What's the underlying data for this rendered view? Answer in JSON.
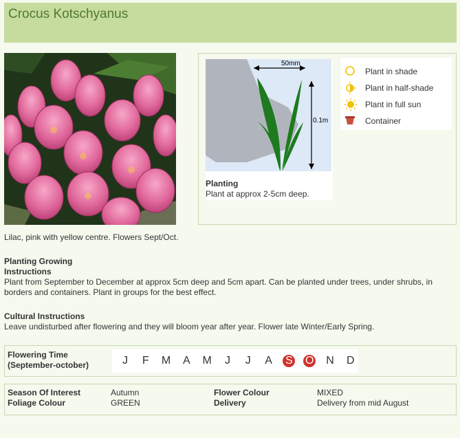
{
  "title": "Crocus Kotschyanus",
  "photo": {
    "alt": "Pink crocus flowers"
  },
  "planting": {
    "width_label": "50mm",
    "height_label": "0.1m",
    "title": "Planting",
    "text": "Plant at approx 2-5cm deep."
  },
  "legend": [
    {
      "label": "Plant in shade",
      "icon": "shade-icon",
      "color": "#f2c200"
    },
    {
      "label": "Plant in half-shade",
      "icon": "half-shade-icon",
      "color": "#f2c200"
    },
    {
      "label": "Plant in full sun",
      "icon": "full-sun-icon",
      "color": "#f2c200"
    },
    {
      "label": "Container",
      "icon": "container-icon",
      "color": "#c8503c"
    }
  ],
  "description": "Lilac, pink with yellow centre. Flowers Sept/Oct.",
  "planting_instructions": {
    "title_line1": "Planting Growing",
    "title_line2": "Instructions",
    "line1": "Plant from September to December at approx 5cm deep and 5cm apart. Can be planted under trees, under shrubs, in",
    "line2": "borders and containers. Plant in groups for the best effect."
  },
  "cultural_instructions": {
    "title": "Cultural Instructions",
    "text": "Leave undisturbed after flowering and they will bloom year after year. Flower late Winter/Early Spring."
  },
  "flowering": {
    "label_line1": "Flowering Time",
    "label_line2": "(September-october)",
    "months": [
      {
        "label": "J",
        "active": false
      },
      {
        "label": "F",
        "active": false
      },
      {
        "label": "M",
        "active": false
      },
      {
        "label": "A",
        "active": false
      },
      {
        "label": "M",
        "active": false
      },
      {
        "label": "J",
        "active": false
      },
      {
        "label": "J",
        "active": false
      },
      {
        "label": "A",
        "active": false
      },
      {
        "label": "S",
        "active": true
      },
      {
        "label": "O",
        "active": true
      },
      {
        "label": "N",
        "active": false
      },
      {
        "label": "D",
        "active": false
      }
    ],
    "active_color": "#d0312d"
  },
  "details": {
    "season_key": "Season Of Interest",
    "season_value": "Autumn",
    "foliage_key": "Foliage Colour",
    "foliage_value": "GREEN",
    "flower_colour_key": "Flower Colour",
    "flower_colour_value": "MIXED",
    "delivery_key": "Delivery",
    "delivery_value": "Delivery from mid August"
  }
}
